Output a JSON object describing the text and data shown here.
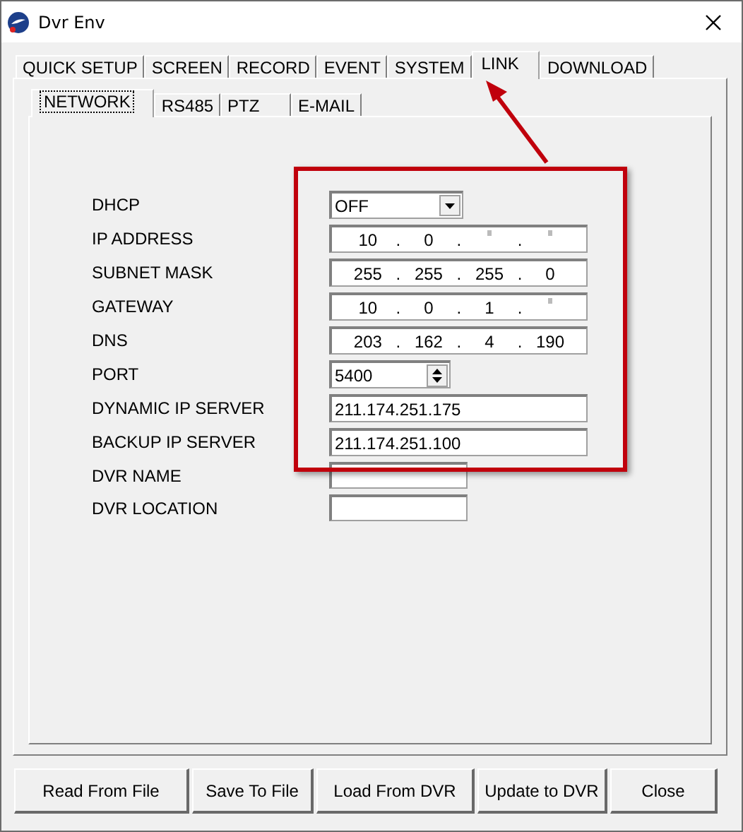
{
  "window": {
    "title": "Dvr Env"
  },
  "tabs": [
    {
      "label": "QUICK SETUP",
      "selected": false
    },
    {
      "label": "SCREEN",
      "selected": false
    },
    {
      "label": "RECORD",
      "selected": false
    },
    {
      "label": "EVENT",
      "selected": false
    },
    {
      "label": "SYSTEM",
      "selected": false
    },
    {
      "label": "LINK",
      "selected": true
    },
    {
      "label": "DOWNLOAD",
      "selected": false
    }
  ],
  "subtabs": [
    {
      "label": "NETWORK",
      "selected": true
    },
    {
      "label": "RS485",
      "selected": false
    },
    {
      "label": "PTZ",
      "selected": false
    },
    {
      "label": "E-MAIL",
      "selected": false
    }
  ],
  "fields": [
    {
      "label": "DHCP",
      "kind": "dropdown",
      "value": "OFF"
    },
    {
      "label": "IP ADDRESS",
      "kind": "ip",
      "separator": ".",
      "octets": [
        {
          "text": "10"
        },
        {
          "text": "0"
        },
        {
          "obscured": true
        },
        {
          "obscured": true
        }
      ]
    },
    {
      "label": "SUBNET MASK",
      "kind": "ip",
      "separator": ".",
      "octets": [
        {
          "text": "255"
        },
        {
          "text": "255"
        },
        {
          "text": "255"
        },
        {
          "text": "0"
        }
      ]
    },
    {
      "label": "GATEWAY",
      "kind": "ip",
      "separator": ".",
      "octets": [
        {
          "text": "10"
        },
        {
          "text": "0"
        },
        {
          "text": "1"
        },
        {
          "obscured": true
        }
      ]
    },
    {
      "label": "DNS",
      "kind": "ip",
      "separator": ".",
      "octets": [
        {
          "text": "203"
        },
        {
          "text": "162"
        },
        {
          "text": "4"
        },
        {
          "text": "190"
        }
      ]
    },
    {
      "label": "PORT",
      "kind": "spin",
      "value": "5400"
    },
    {
      "label": "DYNAMIC IP SERVER",
      "kind": "text",
      "value": "211.174.251.175"
    },
    {
      "label": "BACKUP IP SERVER",
      "kind": "text",
      "value": "211.174.251.100"
    },
    {
      "label": "DVR NAME",
      "kind": "short"
    },
    {
      "label": "DVR LOCATION",
      "kind": "short"
    }
  ],
  "buttons": [
    "Read From File",
    "Save To File",
    "Load From DVR",
    "Update to DVR",
    "Close"
  ]
}
